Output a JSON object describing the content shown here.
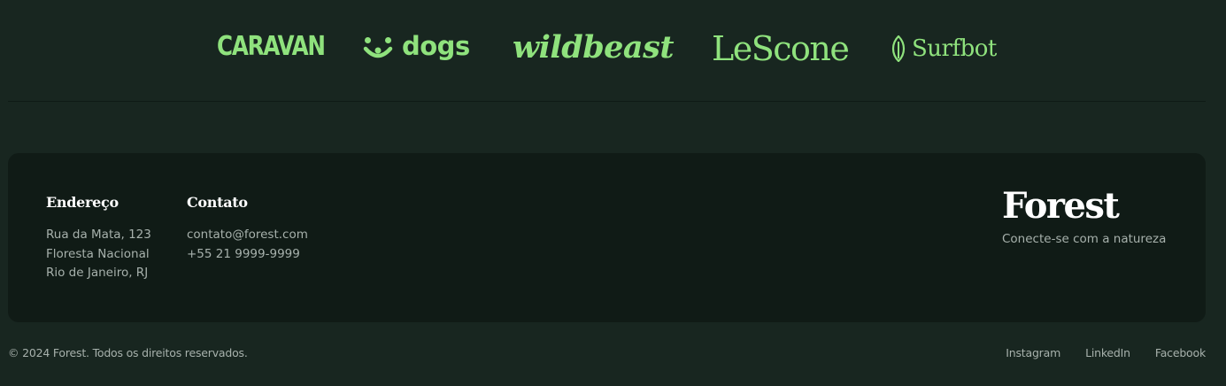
{
  "logos": {
    "caravan": "CARAVAN",
    "dogs": "dogs",
    "wildbeast": "wildbeast",
    "lescone": "LeScone",
    "surfbot": "Surfbot",
    "color": "#8fe27d"
  },
  "footer": {
    "address": {
      "title": "Endereço",
      "lines": [
        "Rua da Mata, 123",
        "Floresta Nacional",
        "Rio de Janeiro, RJ"
      ]
    },
    "contact": {
      "title": "Contato",
      "email": "contato@forest.com",
      "phone": "+55 21 9999-9999"
    },
    "brand": {
      "name": "Forest",
      "tagline": "Conecte-se com a natureza"
    }
  },
  "bottom": {
    "copyright": "© 2024 Forest. Todos os direitos reservados.",
    "social": [
      "Instagram",
      "LinkedIn",
      "Facebook"
    ]
  },
  "colors": {
    "background": "#182620",
    "card": "#101b16",
    "accent": "#8fe27d",
    "muted_text": "#a7b1ac"
  }
}
